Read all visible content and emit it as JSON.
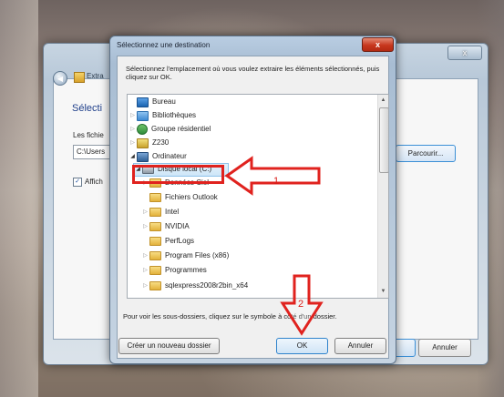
{
  "background_window": {
    "title": "Extra",
    "heading": "Sélecti",
    "files_label": "Les fichie",
    "path_value": "C:\\Users",
    "checkbox_label": "Affich",
    "browse_label": "Parcourir...",
    "cancel_label": "Annuler"
  },
  "dialog": {
    "title": "Sélectionnez une destination",
    "close_label": "x",
    "instruction": "Sélectionnez l'emplacement où vous voulez extraire les éléments sélectionnés, puis cliquez sur OK.",
    "tree_items": [
      {
        "label": "Bureau",
        "icon": "desktop-icon"
      },
      {
        "label": "Bibliothèques",
        "icon": "libraries-icon"
      },
      {
        "label": "Groupe résidentiel",
        "icon": "homegroup-icon"
      },
      {
        "label": "Z230",
        "icon": "user-folder-icon"
      },
      {
        "label": "Ordinateur",
        "icon": "computer-icon"
      },
      {
        "label": "Disque local (C:)",
        "icon": "drive-icon"
      },
      {
        "label": "Données Ciel",
        "icon": "folder-icon"
      },
      {
        "label": "Fichiers Outlook",
        "icon": "folder-icon"
      },
      {
        "label": "Intel",
        "icon": "folder-icon"
      },
      {
        "label": "NVIDIA",
        "icon": "folder-icon"
      },
      {
        "label": "PerfLogs",
        "icon": "folder-icon"
      },
      {
        "label": "Program Files (x86)",
        "icon": "folder-icon"
      },
      {
        "label": "Programmes",
        "icon": "folder-icon"
      },
      {
        "label": "sqlexpress2008r2bin_x64",
        "icon": "folder-icon"
      }
    ],
    "hint": "Pour voir les sous-dossiers, cliquez sur le symbole à côté d'un dossier.",
    "new_folder_label": "Créer un nouveau dossier",
    "ok_label": "OK",
    "cancel_label": "Annuler"
  },
  "annotations": {
    "step1": "1",
    "step2": "2",
    "color": "#e0221e"
  }
}
